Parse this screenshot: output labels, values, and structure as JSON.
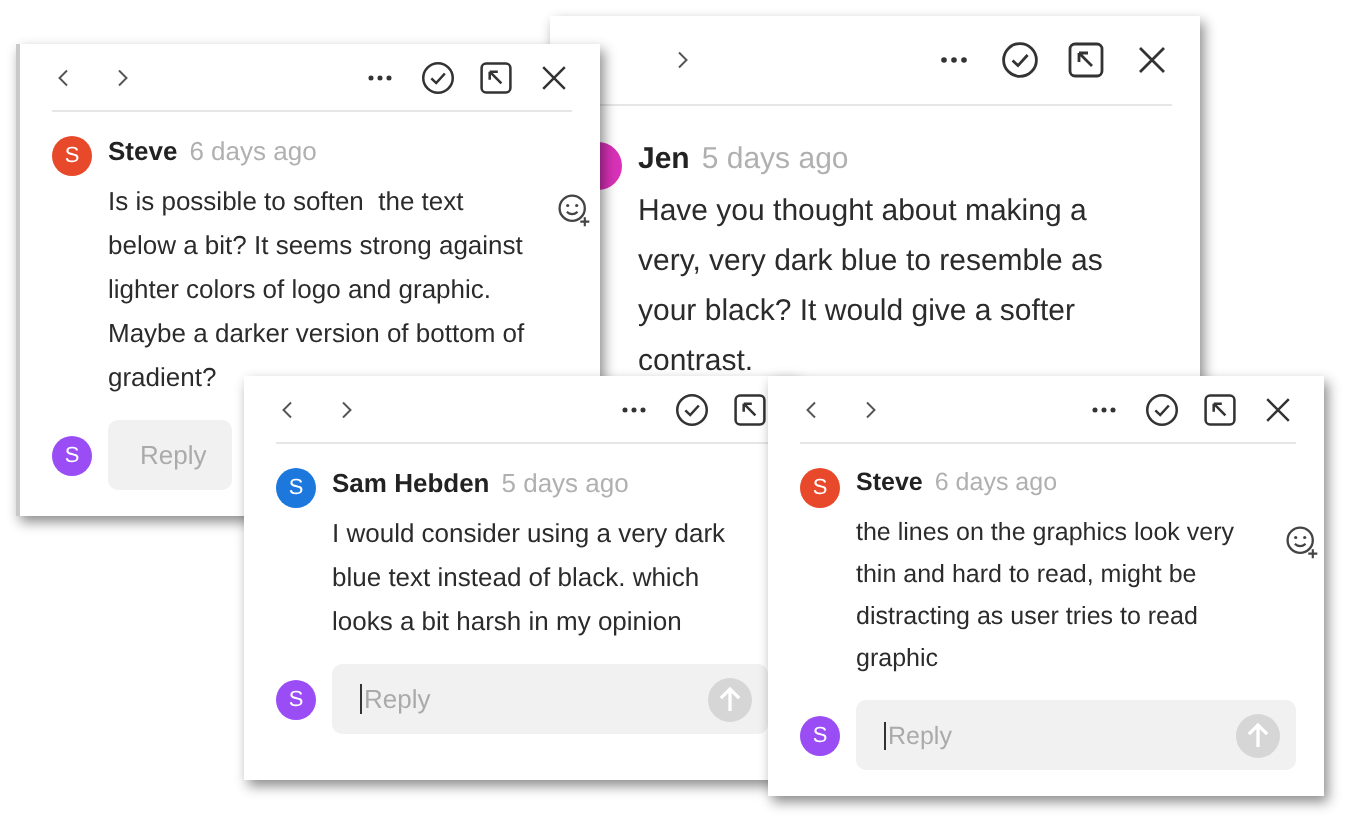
{
  "cards": [
    {
      "show_prev": true,
      "show_close": true,
      "author": {
        "initial": "S",
        "color": "#e8492b"
      },
      "name": "Steve",
      "time": "6 days ago",
      "text": "Is is possible to soften  the text below a bit? It seems strong against lighter colors of logo and graphic. Maybe a darker version of bottom of gradient?",
      "reaction_icon": true,
      "reply": {
        "avatar": {
          "initial": "S",
          "color": "#9a4cf5"
        },
        "placeholder": "Reply",
        "focused": false,
        "send_button": false
      }
    },
    {
      "show_prev": false,
      "show_close": true,
      "author": {
        "color": "#d931b8"
      },
      "name": "Jen",
      "time": "5 days ago",
      "text": "Have you thought about making a very, very dark blue to resemble as your black? It would give a softer contrast.",
      "reaction_icon": false
    },
    {
      "show_prev": true,
      "show_close": false,
      "author": {
        "initial": "S",
        "color": "#1d78de"
      },
      "name": "Sam Hebden",
      "time": "5 days ago",
      "text": "I would consider using a very dark blue text instead of black. which looks a bit harsh in my opinion",
      "reaction_icon": false,
      "reply": {
        "avatar": {
          "initial": "S",
          "color": "#9a4cf5"
        },
        "placeholder": "Reply",
        "focused": true,
        "send_button": true
      }
    },
    {
      "show_prev": true,
      "show_close": true,
      "author": {
        "initial": "S",
        "color": "#e8492b"
      },
      "name": "Steve",
      "time": "6 days ago",
      "text": "the lines on the graphics look very thin and hard to read, might be distracting as user tries to read graphic",
      "reaction_icon": true,
      "reply": {
        "avatar": {
          "initial": "S",
          "color": "#9a4cf5"
        },
        "placeholder": "Reply",
        "focused": true,
        "send_button": true
      }
    }
  ]
}
